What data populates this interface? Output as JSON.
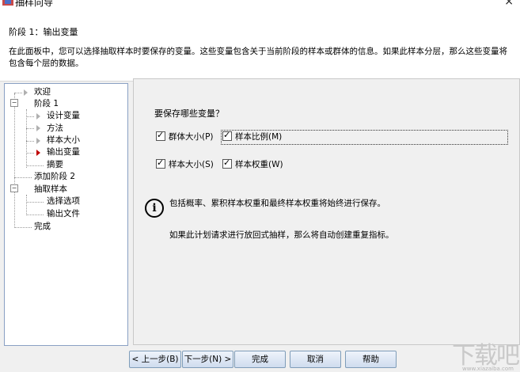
{
  "window": {
    "title": "抽样向导",
    "close": "×"
  },
  "header": {
    "step_title": "阶段 1：输出变量",
    "description": "在此面板中，您可以选择抽取样本时要保存的变量。这些变量包含关于当前阶段的样本或群体的信息。如果此样本分层，那么这些变量将包含每个层的数据。"
  },
  "nav": {
    "items": [
      {
        "label": "欢迎"
      },
      {
        "label": "阶段 1"
      },
      {
        "label": "设计变量"
      },
      {
        "label": "方法"
      },
      {
        "label": "样本大小"
      },
      {
        "label": "输出变量"
      },
      {
        "label": "摘要"
      },
      {
        "label": "添加阶段 2"
      },
      {
        "label": "抽取样本"
      },
      {
        "label": "选择选项"
      },
      {
        "label": "输出文件"
      },
      {
        "label": "完成"
      }
    ]
  },
  "content": {
    "question": "要保存哪些变量？",
    "checkboxes": [
      {
        "label": "群体大小(P)",
        "checked": true
      },
      {
        "label": "样本比例(M)",
        "checked": true
      },
      {
        "label": "样本大小(S)",
        "checked": true
      },
      {
        "label": "样本权重(W)",
        "checked": true
      }
    ],
    "info_line1": "包括概率、累积样本权重和最终样本权重将始终进行保存。",
    "info_line2": "如果此计划请求进行放回式抽样，那么将自动创建重复指标。"
  },
  "buttons": {
    "back": "< 上一步(B)",
    "next": "下一步(N) >",
    "finish": "完成",
    "cancel": "取消",
    "help": "帮助"
  },
  "watermark": {
    "main": "下载吧",
    "sub": "www.xiazaiba.com"
  }
}
